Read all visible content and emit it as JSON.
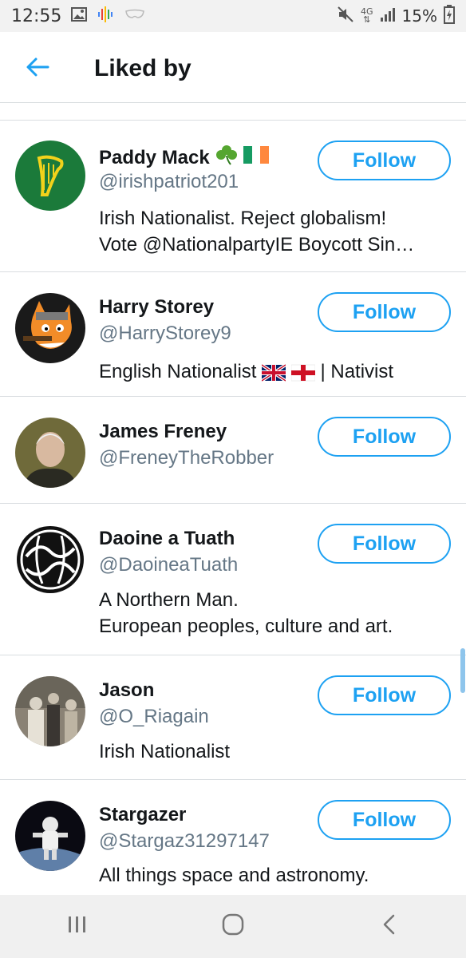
{
  "status_bar": {
    "time": "12:55",
    "network": "4G",
    "battery": "15%",
    "icons": [
      "image-icon",
      "podcast-icon",
      "mask-icon",
      "mute-icon",
      "signal-icon",
      "battery-icon"
    ]
  },
  "header": {
    "back_icon": "back-arrow-icon",
    "title": "Liked by"
  },
  "users": [
    {
      "name": "Paddy Mack",
      "handle": "@irishpatriot201",
      "bio": [
        "Irish Nationalist. Reject globalism!",
        "Vote @NationalpartyIE Boycott Sin…"
      ],
      "emoji": [
        "shamrock-emoji",
        "ireland-flag-emoji"
      ],
      "follow_label": "Follow",
      "avatar": "harp-avatar"
    },
    {
      "name": "Harry Storey",
      "handle": "@HarryStorey9",
      "bio": [
        "English Nationalist",
        "| Nativist"
      ],
      "emoji": [
        "uk-flag-emoji",
        "england-flag-emoji"
      ],
      "follow_label": "Follow",
      "avatar": "cartoon-fox-avatar"
    },
    {
      "name": "James Freney",
      "handle": "@FreneyTheRobber",
      "bio": [],
      "follow_label": "Follow",
      "avatar": "photo-man-avatar"
    },
    {
      "name": "Daoine a Tuath",
      "handle": "@DaoineaTuath",
      "bio": [
        "A Northern Man.",
        "European peoples, culture and art."
      ],
      "follow_label": "Follow",
      "avatar": "celtic-knot-avatar"
    },
    {
      "name": "Jason",
      "handle": "@O_Riagain",
      "bio": [
        "Irish Nationalist"
      ],
      "follow_label": "Follow",
      "avatar": "family-photo-avatar"
    },
    {
      "name": "Stargazer",
      "handle": "@Stargaz31297147",
      "bio": [
        "All things space and astronomy."
      ],
      "follow_label": "Follow",
      "avatar": "astronaut-avatar"
    }
  ],
  "nav_bar": {
    "icons": [
      "recent-apps-icon",
      "home-icon",
      "back-icon"
    ]
  },
  "colors": {
    "accent": "#1da1f2",
    "handle": "#657786",
    "text": "#14171a",
    "divider": "#d9dde0"
  }
}
